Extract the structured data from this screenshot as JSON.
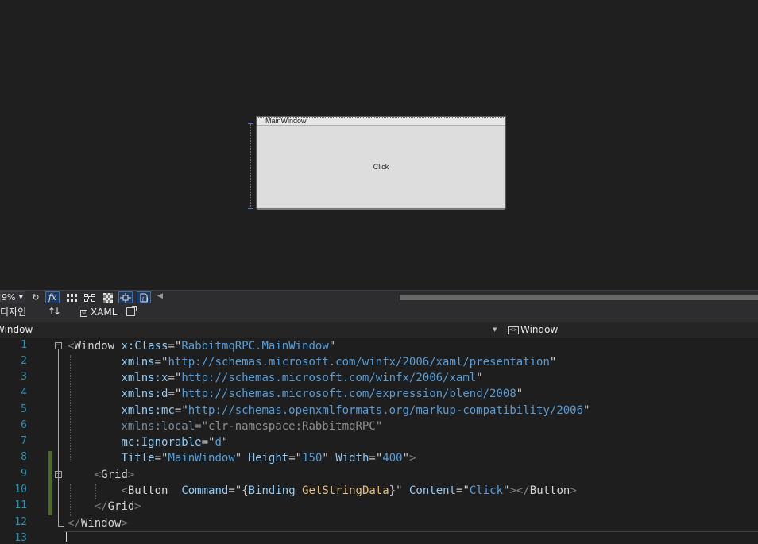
{
  "design": {
    "window_title": "MainWindow",
    "button_content": "Click"
  },
  "toolbar": {
    "zoom": "9%",
    "icons": [
      "refresh-icon",
      "fx-icon",
      "grid-icon",
      "snap-grid-icon",
      "checker-icon",
      "snap-lines-icon",
      "annotation-icon"
    ]
  },
  "tabs": {
    "design": "디자인",
    "swap": "↑↓",
    "xaml": "XAML"
  },
  "nav": {
    "left": "Window",
    "right": "Window"
  },
  "editor": {
    "line_numbers": [
      "1",
      "2",
      "3",
      "4",
      "5",
      "6",
      "7",
      "8",
      "9",
      "10",
      "11",
      "12",
      "13"
    ]
  },
  "code": {
    "l1_open": "<",
    "l1_el": "Window",
    "l1_attr": "x:Class",
    "l1_eq": "=",
    "l1_q1": "\"",
    "l1_val": "RabbitmqRPC.MainWindow",
    "l1_q2": "\"",
    "l2_attr": "xmlns",
    "l2_eq": "=",
    "l2_q1": "\"",
    "l2_val": "http://schemas.microsoft.com/winfx/2006/xaml/presentation",
    "l2_q2": "\"",
    "l3_attr": "xmlns:x",
    "l3_eq": "=",
    "l3_q1": "\"",
    "l3_val": "http://schemas.microsoft.com/winfx/2006/xaml",
    "l3_q2": "\"",
    "l4_attr": "xmlns:d",
    "l4_eq": "=",
    "l4_q1": "\"",
    "l4_val": "http://schemas.microsoft.com/expression/blend/2008",
    "l4_q2": "\"",
    "l5_attr": "xmlns:mc",
    "l5_eq": "=",
    "l5_q1": "\"",
    "l5_val": "http://schemas.openxmlformats.org/markup-compatibility/2006",
    "l5_q2": "\"",
    "l6_attr": "xmlns:local",
    "l6_eq": "=",
    "l6_val": "\"clr-namespace:RabbitmqRPC\"",
    "l7_attr": "mc:Ignorable",
    "l7_eq": "=",
    "l7_q1": "\"",
    "l7_val": "d",
    "l7_q2": "\"",
    "l8_attr1": "Title",
    "l8_eq1": "=",
    "l8_q1": "\"",
    "l8_val1": "MainWindow",
    "l8_q2": "\"",
    "l8_attr2": "Height",
    "l8_eq2": "=",
    "l8_q3": "\"",
    "l8_val2": "150",
    "l8_q4": "\"",
    "l8_attr3": "Width",
    "l8_eq3": "=",
    "l8_q5": "\"",
    "l8_val3": "400",
    "l8_q6": "\"",
    "l8_close": ">",
    "l9_open": "<",
    "l9_el": "Grid",
    "l9_close": ">",
    "l10_open": "<",
    "l10_el": "Button",
    "l10_attr1": "Command",
    "l10_eq1": "=",
    "l10_q1": "\"",
    "l10_b1": "{",
    "l10_bkw": "Binding",
    "l10_bpath": "GetStringData",
    "l10_b2": "}",
    "l10_q2": "\"",
    "l10_attr2": "Content",
    "l10_eq2": "=",
    "l10_q3": "\"",
    "l10_val2": "Click",
    "l10_q4": "\"",
    "l10_mid": "></",
    "l10_el2": "Button",
    "l10_end": ">",
    "l11_open": "</",
    "l11_el": "Grid",
    "l11_close": ">",
    "l12_open": "</",
    "l12_el": "Window",
    "l12_close": ">"
  }
}
